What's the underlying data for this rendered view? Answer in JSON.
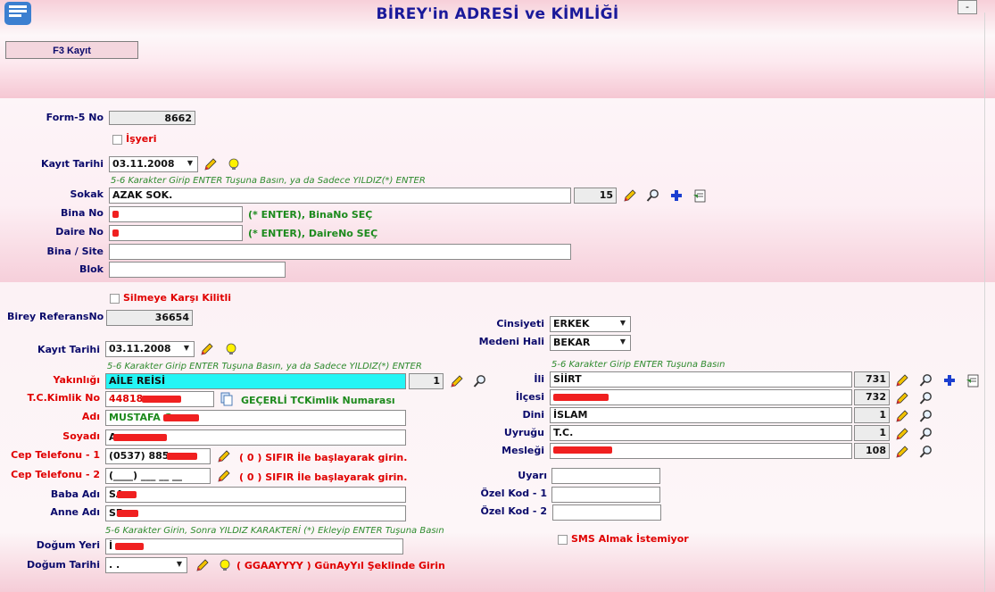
{
  "window": {
    "title": "BİREY'in ADRESİ ve KİMLİĞİ",
    "close_label": "-"
  },
  "toolbar": {
    "save_label": "F3 Kayıt"
  },
  "address": {
    "form5_label": "Form-5 No",
    "form5_value": "8662",
    "isyeri_label": "İşyeri",
    "kayit_label": "Kayıt Tarihi",
    "kayit_value": "03.11.2008",
    "sokak_hint": "5-6 Karakter Girip ENTER Tuşuna Basın, ya da Sadece YILDIZ(*) ENTER",
    "sokak_label": "Sokak",
    "sokak_value": "AZAK SOK.",
    "sokak_code": "15",
    "bina_label": "Bina No",
    "bina_note": "(* ENTER), BinaNo SEÇ",
    "daire_label": "Daire No",
    "daire_note": "(* ENTER), DaireNo SEÇ",
    "site_label": "Bina / Site",
    "blok_label": "Blok"
  },
  "person": {
    "lock_label": "Silmeye Karşı Kilitli",
    "ref_label": "Birey ReferansNo",
    "ref_value": "36654",
    "kayit_label": "Kayıt Tarihi",
    "kayit_value": "03.11.2008",
    "yakin_hint": "5-6 Karakter Girip ENTER Tuşuna Basın, ya da Sadece YILDIZ(*) ENTER",
    "yakin_label": "Yakınlığı",
    "yakin_value": "AİLE REİSİ",
    "yakin_code": "1",
    "tc_label": "T.C.Kimlik No",
    "tc_value": "44818",
    "tc_note": "GEÇERLİ TCKimlik Numarası",
    "adi_label": "Adı",
    "adi_value": "MUSTAFA G",
    "soyadi_label": "Soyadı",
    "soyadi_value": "A",
    "cep1_label": "Cep Telefonu - 1",
    "cep1_value": "(0537) 885",
    "cep1_note": "( 0 ) SIFIR İle başlayarak girin.",
    "cep2_label": "Cep Telefonu - 2",
    "cep2_value": "(____) ___ __ __",
    "cep2_note": "( 0 ) SIFIR İle başlayarak girin.",
    "baba_label": "Baba Adı",
    "baba_value": "SA",
    "anne_label": "Anne Adı",
    "anne_value": "SE",
    "dogum_hint": "5-6 Karakter Girin, Sonra YILDIZ KARAKTERİ (*) Ekleyip ENTER Tuşuna Basın",
    "dogum_yeri_label": "Doğum Yeri",
    "dogum_yeri_value": "İ",
    "dogum_tarihi_label": "Doğum Tarihi",
    "dogum_tarihi_value": ". .",
    "dogum_tarihi_note": "( GGAAYYYY ) GünAyYıl  Şeklinde Girin"
  },
  "right": {
    "cinsiyet_label": "Cinsiyeti",
    "cinsiyet_value": "ERKEK",
    "medeni_label": "Medeni Hali",
    "medeni_value": "BEKAR",
    "il_hint": "5-6 Karakter Girip ENTER Tuşuna Basın",
    "il_label": "İli",
    "il_value": "SİİRT",
    "il_code": "731",
    "ilce_label": "İlçesi",
    "ilce_code": "732",
    "din_label": "Dini",
    "din_value": "İSLAM",
    "din_code": "1",
    "uyruk_label": "Uyruğu",
    "uyruk_value": "T.C.",
    "uyruk_code": "1",
    "meslek_label": "Mesleği",
    "meslek_code": "108",
    "uyari_label": "Uyarı",
    "ozel1_label": "Özel Kod - 1",
    "ozel2_label": "Özel Kod - 2",
    "sms_label": "SMS Almak İstemiyor"
  },
  "colors": {
    "title": "#1a1a9a",
    "label": "#0a0a6b",
    "required_label": "#e00000",
    "hint": "#2d8a2d",
    "highlight_field": "#24f5f5",
    "redaction": "#f02020"
  }
}
